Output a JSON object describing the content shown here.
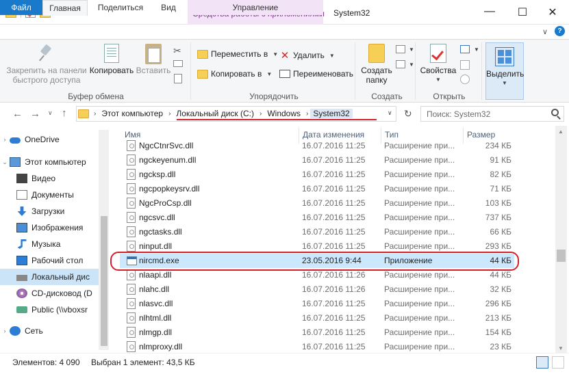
{
  "window": {
    "context_title": "Средства работы с приложениями",
    "title": "System32",
    "minimize": "—",
    "maximize": "☐",
    "close": "✕"
  },
  "tabs": {
    "file": "Файл",
    "home": "Главная",
    "share": "Поделиться",
    "view": "Вид",
    "manage": "Управление",
    "collapse": "∨",
    "help": "?"
  },
  "ribbon": {
    "clipboard": {
      "pin_label": "Закрепить на панели быстрого доступа",
      "pin_line1": "Закрепить на панели",
      "pin_line2": "быстрого доступа",
      "copy": "Копировать",
      "paste": "Вставить",
      "group": "Буфер обмена"
    },
    "organize": {
      "move_to": "Переместить в",
      "copy_to": "Копировать в",
      "delete": "Удалить",
      "rename": "Переименовать",
      "group": "Упорядочить"
    },
    "new": {
      "new_folder_line1": "Создать",
      "new_folder_line2": "папку",
      "group": "Создать"
    },
    "open": {
      "properties": "Свойства",
      "group": "Открыть"
    },
    "select": {
      "select": "Выделить"
    }
  },
  "address": {
    "crumbs": [
      "Этот компьютер",
      "Локальный диск (C:)",
      "Windows",
      "System32"
    ],
    "search_placeholder": "Поиск: System32"
  },
  "nav": {
    "items": [
      {
        "label": "OneDrive",
        "icon": "cloud-icon"
      },
      {
        "label": "Этот компьютер",
        "icon": "computer-icon"
      },
      {
        "label": "Видео",
        "icon": "video-icon"
      },
      {
        "label": "Документы",
        "icon": "documents-icon"
      },
      {
        "label": "Загрузки",
        "icon": "downloads-icon"
      },
      {
        "label": "Изображения",
        "icon": "images-icon"
      },
      {
        "label": "Музыка",
        "icon": "music-icon"
      },
      {
        "label": "Рабочий стол",
        "icon": "desktop-icon"
      },
      {
        "label": "Локальный дис",
        "icon": "local-disk-icon"
      },
      {
        "label": "CD-дисковод (D",
        "icon": "cd-drive-icon"
      },
      {
        "label": "Public (\\\\vboxsr",
        "icon": "network-drive-icon"
      },
      {
        "label": "Сеть",
        "icon": "network-icon"
      }
    ]
  },
  "columns": {
    "name": "Имя",
    "date": "Дата изменения",
    "type": "Тип",
    "size": "Размер"
  },
  "files": [
    {
      "name": "NgcCtnrSvc.dll",
      "date": "16.07.2016 11:25",
      "type": "Расширение при...",
      "size": "234 КБ"
    },
    {
      "name": "ngckeyenum.dll",
      "date": "16.07.2016 11:25",
      "type": "Расширение при...",
      "size": "91 КБ"
    },
    {
      "name": "ngcksp.dll",
      "date": "16.07.2016 11:25",
      "type": "Расширение при...",
      "size": "82 КБ"
    },
    {
      "name": "ngcpopkeysrv.dll",
      "date": "16.07.2016 11:25",
      "type": "Расширение при...",
      "size": "71 КБ"
    },
    {
      "name": "NgcProCsp.dll",
      "date": "16.07.2016 11:25",
      "type": "Расширение при...",
      "size": "103 КБ"
    },
    {
      "name": "ngcsvc.dll",
      "date": "16.07.2016 11:25",
      "type": "Расширение при...",
      "size": "737 КБ"
    },
    {
      "name": "ngctasks.dll",
      "date": "16.07.2016 11:25",
      "type": "Расширение при...",
      "size": "66 КБ"
    },
    {
      "name": "ninput.dll",
      "date": "16.07.2016 11:25",
      "type": "Расширение при...",
      "size": "293 КБ"
    },
    {
      "name": "nircmd.exe",
      "date": "23.05.2016 9:44",
      "type": "Приложение",
      "size": "44 КБ"
    },
    {
      "name": "nlaapi.dll",
      "date": "16.07.2016 11:26",
      "type": "Расширение при...",
      "size": "44 КБ"
    },
    {
      "name": "nlahc.dll",
      "date": "16.07.2016 11:26",
      "type": "Расширение при...",
      "size": "32 КБ"
    },
    {
      "name": "nlasvc.dll",
      "date": "16.07.2016 11:25",
      "type": "Расширение при...",
      "size": "296 КБ"
    },
    {
      "name": "nlhtml.dll",
      "date": "16.07.2016 11:25",
      "type": "Расширение при...",
      "size": "213 КБ"
    },
    {
      "name": "nlmgp.dll",
      "date": "16.07.2016 11:25",
      "type": "Расширение при...",
      "size": "154 КБ"
    },
    {
      "name": "nlmproxy.dll",
      "date": "16.07.2016 11:25",
      "type": "Расширение при...",
      "size": "23 КБ"
    }
  ],
  "status": {
    "count": "Элементов: 4 090",
    "selected": "Выбран 1 элемент: 43,5 КБ"
  },
  "colors": {
    "file_tab": "#1979ca",
    "context_tab": "#f3e3f7",
    "selection": "#cce8ff",
    "annotation_red": "#d21f2a"
  }
}
